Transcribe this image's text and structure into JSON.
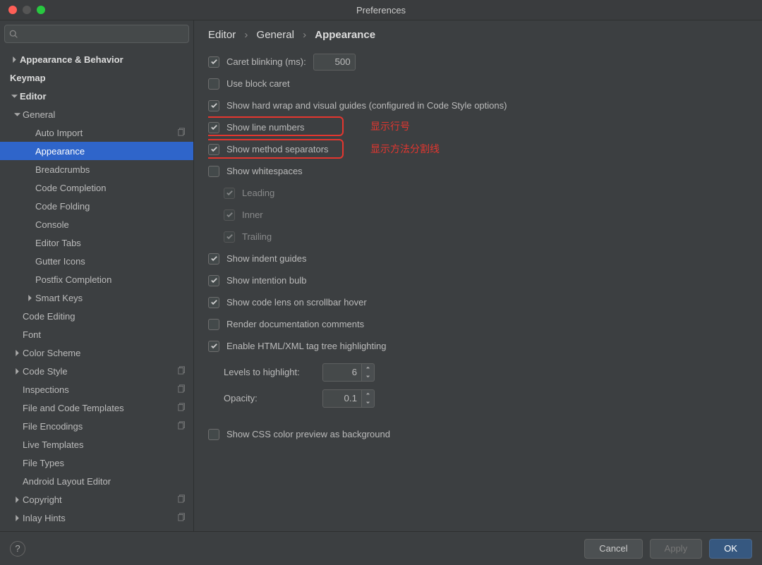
{
  "title": "Preferences",
  "search_placeholder": "",
  "sidebar": [
    {
      "label": "Appearance & Behavior",
      "level": 0,
      "arrow": "right"
    },
    {
      "label": "Keymap",
      "level": 0,
      "arrow": ""
    },
    {
      "label": "Editor",
      "level": 0,
      "arrow": "down"
    },
    {
      "label": "General",
      "level": 1,
      "arrow": "down"
    },
    {
      "label": "Auto Import",
      "level": 2,
      "arrow": "",
      "copy": true
    },
    {
      "label": "Appearance",
      "level": 2,
      "arrow": "",
      "selected": true
    },
    {
      "label": "Breadcrumbs",
      "level": 2,
      "arrow": ""
    },
    {
      "label": "Code Completion",
      "level": 2,
      "arrow": ""
    },
    {
      "label": "Code Folding",
      "level": 2,
      "arrow": ""
    },
    {
      "label": "Console",
      "level": 2,
      "arrow": ""
    },
    {
      "label": "Editor Tabs",
      "level": 2,
      "arrow": ""
    },
    {
      "label": "Gutter Icons",
      "level": 2,
      "arrow": ""
    },
    {
      "label": "Postfix Completion",
      "level": 2,
      "arrow": ""
    },
    {
      "label": "Smart Keys",
      "level": 2,
      "arrow": "right"
    },
    {
      "label": "Code Editing",
      "level": 1,
      "arrow": ""
    },
    {
      "label": "Font",
      "level": 1,
      "arrow": ""
    },
    {
      "label": "Color Scheme",
      "level": 1,
      "arrow": "right"
    },
    {
      "label": "Code Style",
      "level": 1,
      "arrow": "right",
      "copy": true
    },
    {
      "label": "Inspections",
      "level": 1,
      "arrow": "",
      "copy": true
    },
    {
      "label": "File and Code Templates",
      "level": 1,
      "arrow": "",
      "copy": true
    },
    {
      "label": "File Encodings",
      "level": 1,
      "arrow": "",
      "copy": true
    },
    {
      "label": "Live Templates",
      "level": 1,
      "arrow": ""
    },
    {
      "label": "File Types",
      "level": 1,
      "arrow": ""
    },
    {
      "label": "Android Layout Editor",
      "level": 1,
      "arrow": ""
    },
    {
      "label": "Copyright",
      "level": 1,
      "arrow": "right",
      "copy": true
    },
    {
      "label": "Inlay Hints",
      "level": 1,
      "arrow": "right",
      "copy": true
    }
  ],
  "breadcrumb": [
    "Editor",
    "General",
    "Appearance"
  ],
  "settings": {
    "caret_blink_label": "Caret blinking (ms):",
    "caret_blink_value": "500",
    "use_block_caret": "Use block caret",
    "hard_wrap": "Show hard wrap and visual guides (configured in Code Style options)",
    "line_numbers": "Show line numbers",
    "method_separators": "Show method separators",
    "whitespaces": "Show whitespaces",
    "leading": "Leading",
    "inner": "Inner",
    "trailing": "Trailing",
    "indent_guides": "Show indent guides",
    "intention_bulb": "Show intention bulb",
    "code_lens": "Show code lens on scrollbar hover",
    "render_doc": "Render documentation comments",
    "html_tag": "Enable HTML/XML tag tree highlighting",
    "levels_label": "Levels to highlight:",
    "levels_value": "6",
    "opacity_label": "Opacity:",
    "opacity_value": "0.1",
    "css_preview": "Show CSS color preview as background"
  },
  "annotations": {
    "line_numbers": "显示行号",
    "method_separators": "显示方法分割线"
  },
  "buttons": {
    "cancel": "Cancel",
    "apply": "Apply",
    "ok": "OK"
  }
}
